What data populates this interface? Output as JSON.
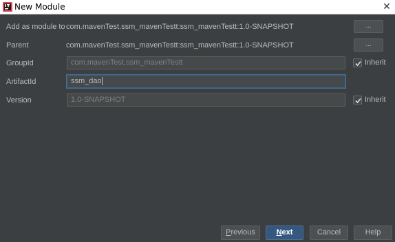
{
  "window": {
    "title": "New Module",
    "close_glyph": "✕"
  },
  "form": {
    "add_as_module": {
      "label": "Add as module to",
      "value": "com.mavenTest.ssm_mavenTestt:ssm_mavenTestt:1.0-SNAPSHOT",
      "browse_label": "..."
    },
    "parent": {
      "label": "Parent",
      "value": "com.mavenTest.ssm_mavenTestt:ssm_mavenTestt:1.0-SNAPSHOT",
      "browse_label": "..."
    },
    "group_id": {
      "label": "GroupId",
      "value": "com.mavenTest.ssm_mavenTestt",
      "inherit_label": "Inherit",
      "inherit_checked": true
    },
    "artifact_id": {
      "label": "ArtifactId",
      "value": "ssm_dao"
    },
    "version": {
      "label": "Version",
      "value": "1.0-SNAPSHOT",
      "inherit_label": "Inherit",
      "inherit_checked": true
    }
  },
  "buttons": {
    "previous_mnemonic": "P",
    "previous_rest": "revious",
    "next_mnemonic": "N",
    "next_rest": "ext",
    "cancel": "Cancel",
    "help": "Help"
  },
  "colors": {
    "background": "#3c3f41",
    "field_bg": "#45494a",
    "focus_border": "#466d94",
    "default_button": "#365880"
  },
  "icons": {
    "app": "intellij-app-icon",
    "close": "close-icon",
    "check": "checkmark-icon"
  }
}
